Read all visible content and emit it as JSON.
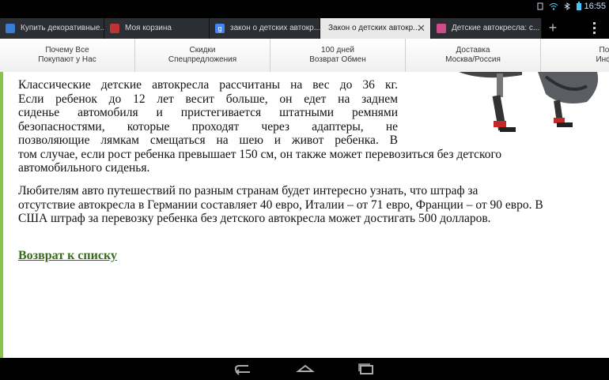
{
  "status": {
    "time": "16:55"
  },
  "tabs": [
    {
      "label": "Купить декоративные...",
      "active": false
    },
    {
      "label": "Моя корзина",
      "active": false
    },
    {
      "label": "закон о детских автокр...",
      "active": false
    },
    {
      "label": "Закон о детских автокр...",
      "active": true
    },
    {
      "label": "Детские автокресла: с...",
      "active": false
    }
  ],
  "nav": [
    {
      "line1": "Почему Все",
      "line2": "Покупают у Нас"
    },
    {
      "line1": "Скидки",
      "line2": "Спецпредложения"
    },
    {
      "line1": "100 дней",
      "line2": "Возврат Обмен"
    },
    {
      "line1": "Доставка",
      "line2": "Москва/Россия"
    },
    {
      "line1": "Поле",
      "line2": "Инфор"
    }
  ],
  "article": {
    "para1_lines": [
      "Классические детские автокресла рассчитаны на вес до 36 кг.",
      "Если ребенок до 12 лет весит больше, он едет на заднем",
      "сиденье автомобиля и пристегивается штатными ремнями",
      "безопасностями, которые проходят через адаптеры, не",
      "позволяющие лямкам смещаться на шею и живот ребенка.  В",
      "том случае, если рост ребенка превышает 150 см, он также может перевозиться без детского",
      "автомобильного сиденья."
    ],
    "para2_lines": [
      "Любителям авто путешествий по разным странам будет интересно узнать, что штраф за",
      "отсутствие автокресла в Германии составляет 40 евро, Италии – от 71 евро, Франции – от 90 евро. В",
      "США штраф за перевозку ребенка без детского автокресла может достигать 500 долларов."
    ],
    "back_link": "Возврат к списку"
  }
}
